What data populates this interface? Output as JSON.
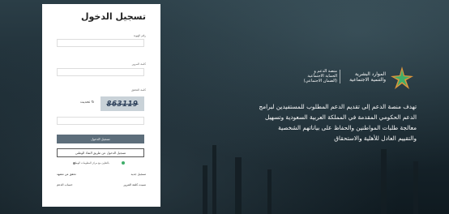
{
  "login": {
    "title": "تسجيل الدخول",
    "id_label": "رقم الهوية",
    "password_label": "كلمة المرور",
    "captcha_label": "كلمة التحقق",
    "captcha_value": "863119",
    "refresh_label": "تحديث",
    "login_button": "تسجيل الدخول",
    "national_access_button": "تسجيل الدخول عن طريق النفاذ الوطني",
    "note": "بالتعاون مع مركز المعلومات الوطني",
    "links": {
      "register": "تسجيل جديد",
      "verify": "تحقق من مشهد",
      "forgot_password": "نسيت كلمة المرور",
      "support_account": "حساب الدعم"
    }
  },
  "branding": {
    "ministry_name": "الموارد البشرية\nوالتنمية الاجتماعية",
    "platform_name": "منصة الدعم و\nالحماية الاجتماعية\n(الضمان الاجتماعي)"
  },
  "description": "تهدف منصة الدعم إلى تقديم الدعم المطلوب للمستفيدين لبرامج الدعم الحكومي المقدمة في المملكة العربية السعودية وتسهيل معالجة طلبات المواطنين والحفاظ على بياناتهم الشخصية والتقييم العادل للأهلية والاستحقاق",
  "colors": {
    "primary_button": "#5d6e7b",
    "logo_orange": "#f2a13a",
    "logo_green": "#3fae6a"
  }
}
